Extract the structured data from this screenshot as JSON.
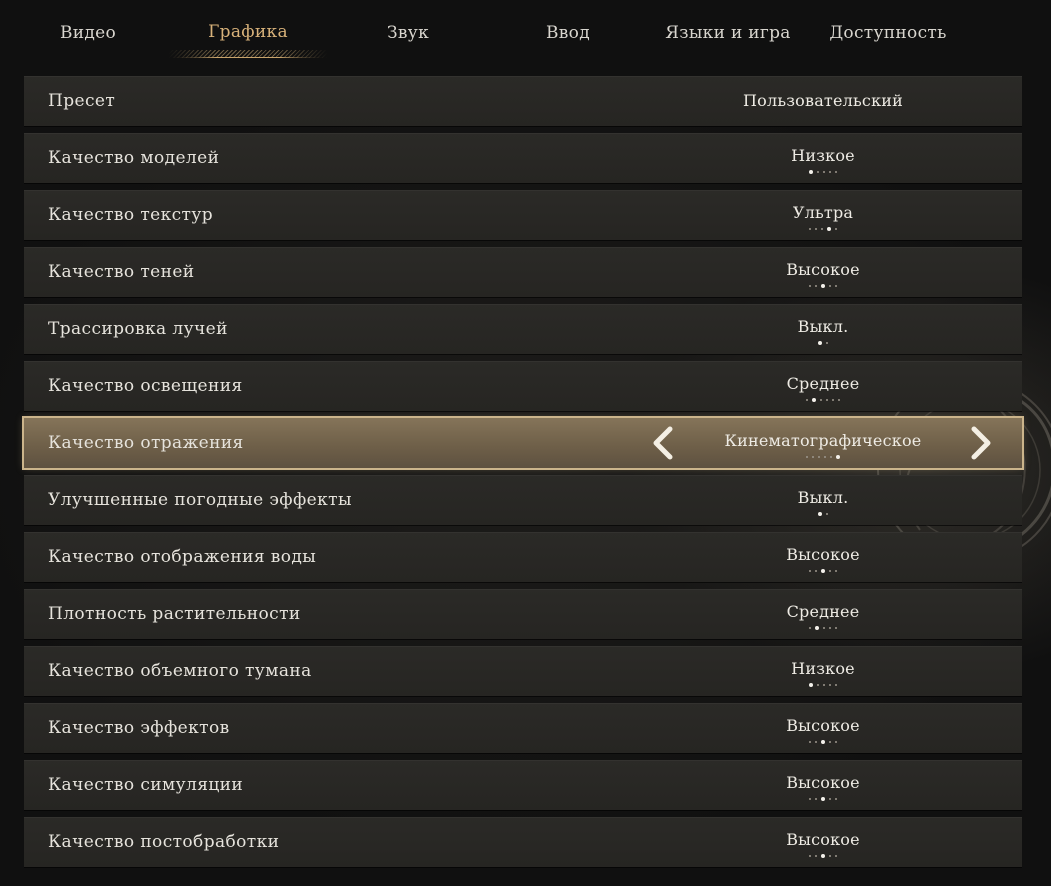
{
  "tabs": [
    {
      "label": "Видео",
      "active": false
    },
    {
      "label": "Графика",
      "active": true
    },
    {
      "label": "Звук",
      "active": false
    },
    {
      "label": "Ввод",
      "active": false
    },
    {
      "label": "Языки и игра",
      "active": false
    },
    {
      "label": "Доступность",
      "active": false
    }
  ],
  "settings": [
    {
      "label": "Пресет",
      "value": "Пользовательский",
      "levels": 0,
      "selected_level": 0
    },
    {
      "label": "Качество моделей",
      "value": "Низкое",
      "levels": 5,
      "selected_level": 1
    },
    {
      "label": "Качество текстур",
      "value": "Ультра",
      "levels": 5,
      "selected_level": 4
    },
    {
      "label": "Качество теней",
      "value": "Высокое",
      "levels": 5,
      "selected_level": 3
    },
    {
      "label": "Трассировка лучей",
      "value": "Выкл.",
      "levels": 2,
      "selected_level": 1
    },
    {
      "label": "Качество освещения",
      "value": "Среднее",
      "levels": 6,
      "selected_level": 2
    },
    {
      "label": "Качество отражения",
      "value": "Кинематографическое",
      "levels": 6,
      "selected_level": 6,
      "selected": true
    },
    {
      "label": "Улучшенные погодные эффекты",
      "value": "Выкл.",
      "levels": 2,
      "selected_level": 1
    },
    {
      "label": "Качество отображения воды",
      "value": "Высокое",
      "levels": 5,
      "selected_level": 3
    },
    {
      "label": "Плотность растительности",
      "value": "Среднее",
      "levels": 5,
      "selected_level": 2
    },
    {
      "label": "Качество объемного тумана",
      "value": "Низкое",
      "levels": 5,
      "selected_level": 1
    },
    {
      "label": "Качество эффектов",
      "value": "Высокое",
      "levels": 5,
      "selected_level": 3
    },
    {
      "label": "Качество симуляции",
      "value": "Высокое",
      "levels": 5,
      "selected_level": 3
    },
    {
      "label": "Качество постобработки",
      "value": "Высокое",
      "levels": 5,
      "selected_level": 3
    }
  ],
  "colors": {
    "active_tab": "#d8b27a",
    "row_background": "#2a2926",
    "selected_row": "#7a6b53",
    "selected_border": "#cbb48b",
    "text": "#e6e3dc"
  },
  "icons": {
    "prev": "chevron-left-icon",
    "next": "chevron-right-icon"
  }
}
